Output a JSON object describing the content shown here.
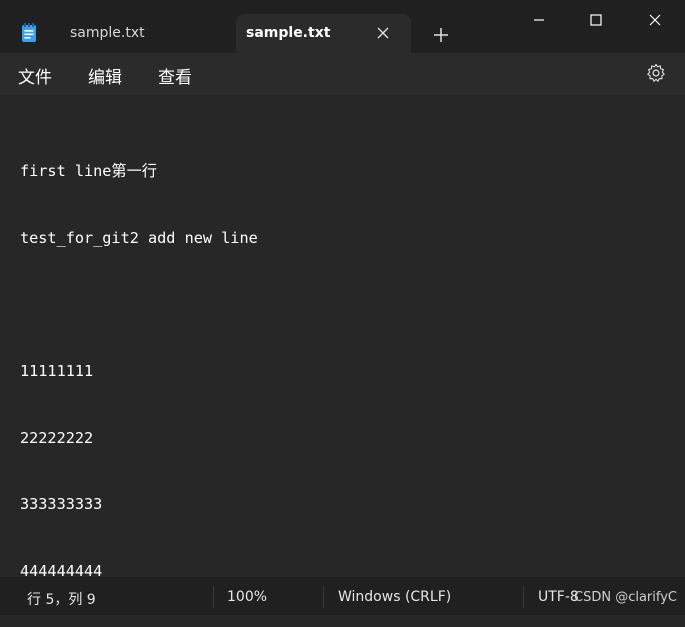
{
  "tabs": [
    {
      "label": "sample.txt",
      "active": false
    },
    {
      "label": "sample.txt",
      "active": true
    }
  ],
  "menu": {
    "file": "文件",
    "edit": "编辑",
    "view": "查看"
  },
  "editor": {
    "lines": [
      "first line第一行",
      "test_for_git2 add new line",
      "",
      "11111111",
      "22222222",
      "333333333",
      "444444444"
    ]
  },
  "status": {
    "position": "行 5，列 9",
    "zoom": "100%",
    "line_ending": "Windows (CRLF)",
    "encoding": "UTF-8"
  },
  "watermark": "CSDN @clarifyC",
  "icons": {
    "app": "notepad-icon",
    "close_tab": "close-icon",
    "new_tab": "plus-icon",
    "minimize": "minimize-icon",
    "maximize": "maximize-icon",
    "close_window": "close-window-icon",
    "settings": "gear-icon"
  },
  "colors": {
    "titlebar": "#202020",
    "active_tab": "#2b2b2b",
    "editor_bg": "#272727",
    "text": "#ffffff",
    "accent": "#1e7fd8"
  }
}
